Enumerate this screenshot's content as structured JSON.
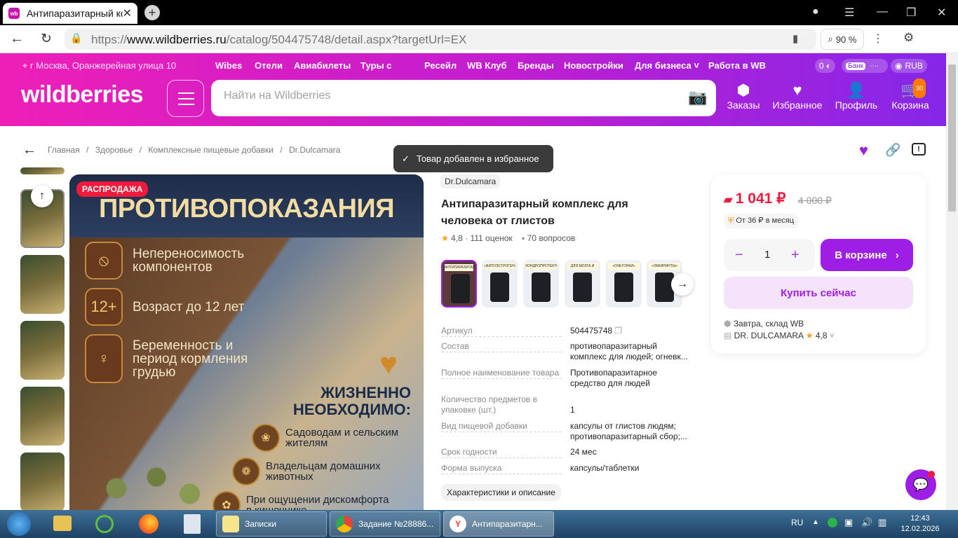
{
  "browser": {
    "tab_title": "Антипаразитарный ко",
    "tab_close": "✕",
    "new_tab": "+",
    "url_scheme": "https://",
    "url_host": "www.wildberries.ru",
    "url_path": "/catalog/504475748/detail.aspx?targetUrl=EX",
    "zoom": "90 %"
  },
  "header": {
    "location": "г Москва, Оранжерейная улица 10",
    "links": [
      "Wibes",
      "Отели",
      "Авиабилеты",
      "Туры с",
      "Ресейл",
      "WB Клуб",
      "Бренды",
      "Новостройки",
      "Для бизнеса",
      "Работа в WB"
    ],
    "balance": "0",
    "bank": "Банк",
    "currency": "RUB",
    "logo": "wildberries",
    "search_placeholder": "Найти на Wildberries",
    "actions": [
      {
        "label": "Заказы"
      },
      {
        "label": "Избранное"
      },
      {
        "label": "Профиль"
      },
      {
        "label": "Корзина"
      }
    ],
    "cart_count": "30"
  },
  "breadcrumbs": [
    "Главная",
    "/",
    "Здоровье",
    "/",
    "Комплексные пищевые добавки",
    "/",
    "Dr.Dulcamara"
  ],
  "toast": "Товар добавлен в избранное",
  "gallery": {
    "sale_badge": "РАСПРОДАЖА",
    "title": "ПРОТИВОПОКАЗАНИЯ",
    "contra": [
      {
        "icon": "⦸",
        "text": "Непереносимость компонентов"
      },
      {
        "icon": "12+",
        "text": "Возраст до 12 лет"
      },
      {
        "icon": "♀",
        "text": "Беременность и период кормления грудью"
      }
    ],
    "need_title": "ЖИЗНЕННО НЕОБХОДИМО:",
    "groups": [
      {
        "icon": "❀",
        "text": "Садоводам и сельским жителям"
      },
      {
        "icon": "❁",
        "text": "Владельцам домашних животных"
      },
      {
        "icon": "✿",
        "text": "При ощущении дискомфорта в кишечнике"
      }
    ]
  },
  "product": {
    "brand": "Dr.Dulcamara",
    "title": "Антипаразитарный комплекс для человека от глистов",
    "rating": "4,8",
    "reviews": "111 оценок",
    "questions": "70 вопросов",
    "variant_labels": [
      "АНТИПАРАЗИТАРНЫЙ",
      "«ФИТОЭСТРОГЕН» ДЛЯ ЖЕНЩИН",
      "ХОНДРОПРОТЕКТОР ДЛЯ СУСТАВОВ",
      "ДЛЯ МОЗГА И ПАМЯТИ",
      "«ОЧЕГОНКИ»",
      "«ЛАБИРИНТЫ»"
    ],
    "specs": [
      {
        "k": "Артикул",
        "v": "504475748"
      },
      {
        "k": "Состав",
        "v": "противопаразитарный комплекс для людей; огневк..."
      },
      {
        "k": "Полное наименование товара",
        "v": "Противопаразитарное средство для людей"
      },
      {
        "k": "Количество предметов в упаковке (шт.)",
        "v": "1"
      },
      {
        "k": "Вид пищевой добавки",
        "v": "капсулы от глистов людям; противопаразитарный сбор;..."
      },
      {
        "k": "Срок годности",
        "v": "24 мес"
      },
      {
        "k": "Форма выпуска",
        "v": "капсулы/таблетки"
      }
    ],
    "char_button": "Характеристики и описание"
  },
  "buy": {
    "price": "1 041 ₽",
    "old_price": "4 000 ₽",
    "credit": "От 36 ₽ в месяц",
    "qty": "1",
    "minus": "−",
    "plus": "+",
    "in_cart": "В корзине",
    "buy_now": "Купить сейчас",
    "delivery": "Завтра, склад WB",
    "seller": "DR. DULCAMARA",
    "seller_rating": "4,8"
  },
  "taskbar": {
    "items": [
      "Записки",
      "Задание №28886...",
      "Антипаразитарн..."
    ],
    "lang": "RU",
    "time": "12:43",
    "date": "12.02.2026"
  },
  "colors": {
    "brand_pink": "#ee1fb7",
    "brand_purple": "#8527e8",
    "price_red": "#f21a3c",
    "button_purple": "#9f1ee6"
  }
}
